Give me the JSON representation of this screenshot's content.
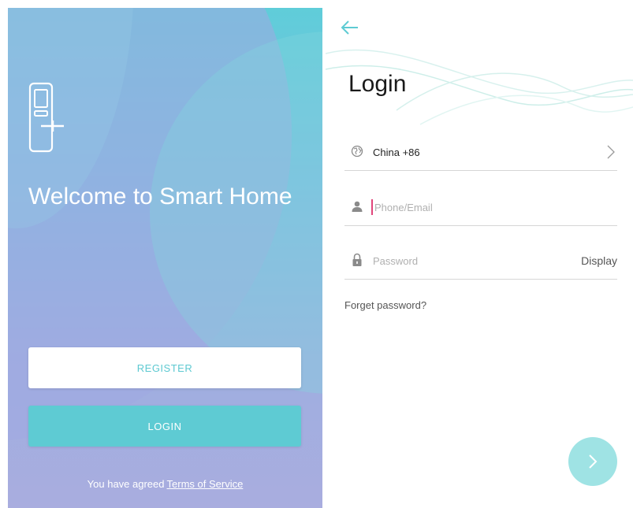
{
  "welcome": {
    "title": "Welcome to Smart Home",
    "register_label": "REGISTER",
    "login_label": "LOGIN",
    "terms_prefix": "You have agreed",
    "terms_link": "Terms of Service",
    "lock_icon": "smart-lock-icon"
  },
  "login": {
    "title": "Login",
    "back_icon": "arrow-left-icon",
    "country": {
      "icon": "globe-icon",
      "value": "China +86",
      "chevron": "chevron-right-icon"
    },
    "phone": {
      "icon": "user-icon",
      "placeholder": "Phone/Email",
      "value": ""
    },
    "password": {
      "icon": "lock-icon",
      "placeholder": "Password",
      "value": "",
      "display_label": "Display"
    },
    "forget_label": "Forget password?",
    "next_icon": "chevron-right-icon"
  },
  "colors": {
    "accent": "#5ecbd3",
    "gradient_top": "#5fcdd9",
    "gradient_bottom": "#a9addf",
    "next_button": "#9fe3e4",
    "cursor": "#e0457a"
  }
}
